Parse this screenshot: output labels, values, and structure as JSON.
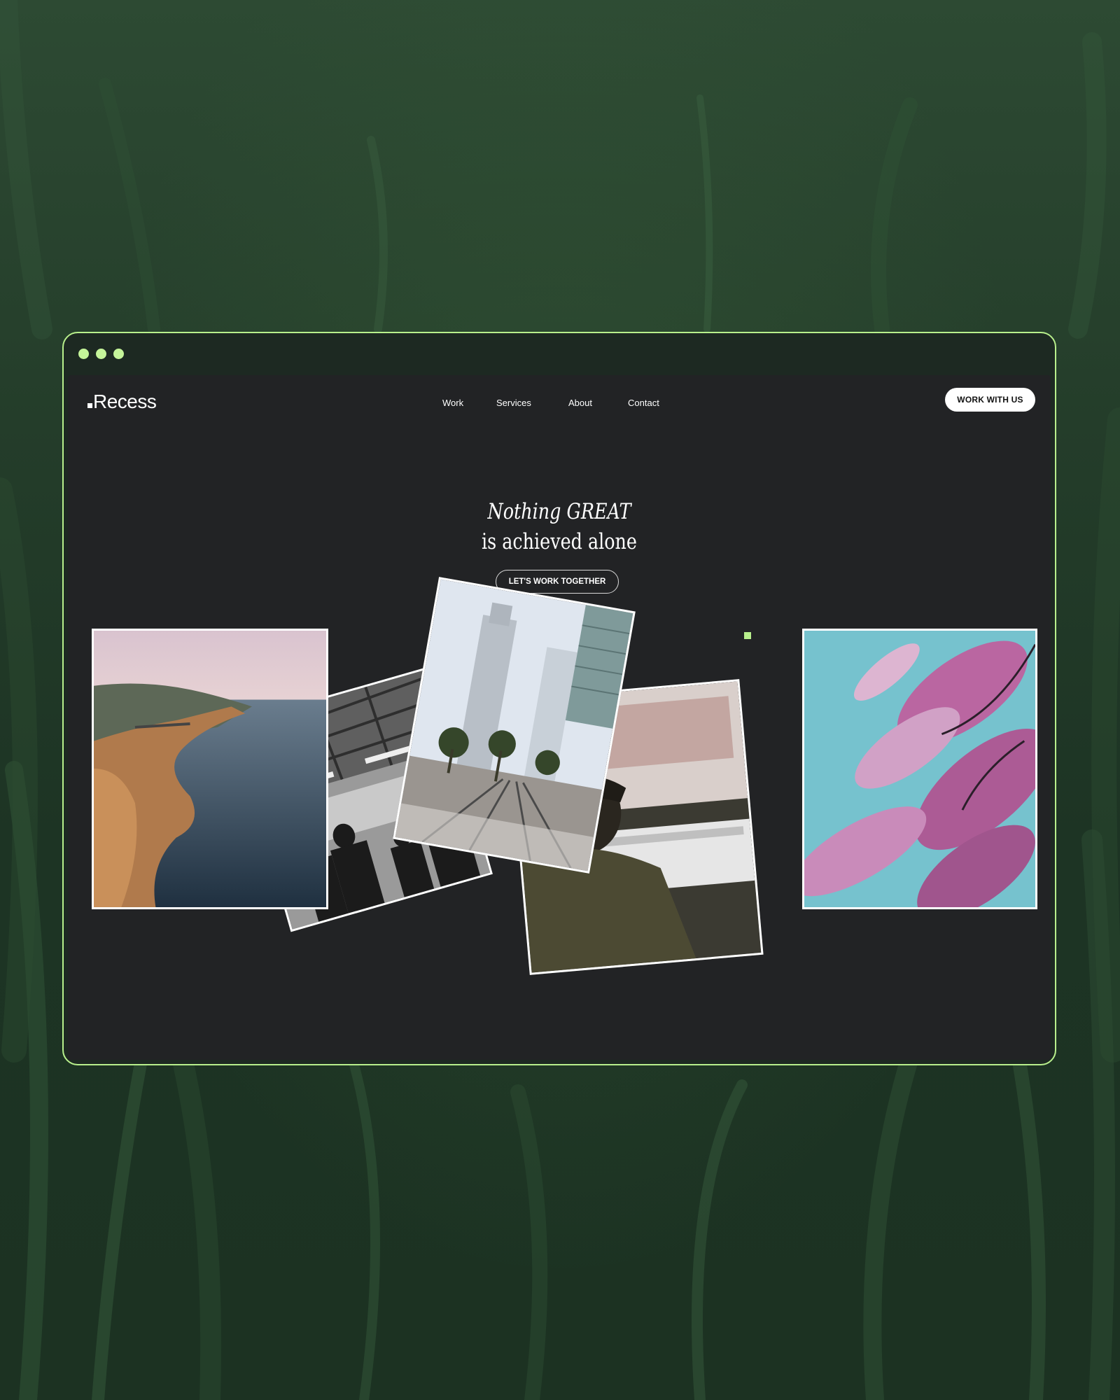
{
  "window": {
    "dots": [
      "#c5f59a",
      "#c5f59a",
      "#c5f59a"
    ],
    "accent": "#b8f08c"
  },
  "header": {
    "logo": "Recess",
    "nav": [
      "Work",
      "Services",
      "About",
      "Contact"
    ],
    "cta": "WORK WITH US"
  },
  "hero": {
    "line1": "Nothing GREAT",
    "line2": "is achieved alone",
    "cta": "LET'S WORK TOGETHER"
  },
  "photos": [
    {
      "name": "coastal-cliffs-photo"
    },
    {
      "name": "warehouse-crowd-photo"
    },
    {
      "name": "city-skyline-photo"
    },
    {
      "name": "designer-at-screen-photo"
    },
    {
      "name": "pink-blossoms-photo"
    }
  ]
}
